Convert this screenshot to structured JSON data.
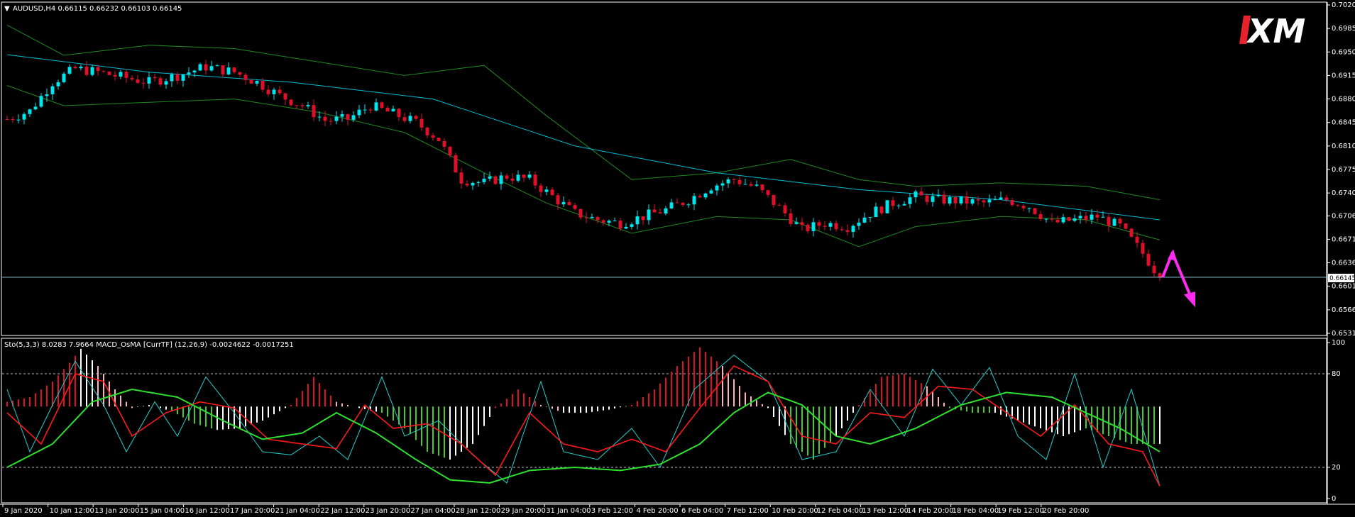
{
  "header": {
    "symbol_line": "AUDUSD,H4  0.66115 0.66232 0.66103 0.66145",
    "indicator_line": "Sto(5,3,3) 8.0283 7.9664  MACD_OsMA [CurrTF] (12,26,9) -0.0024622 -0.0017251"
  },
  "logo": {
    "text": "XM",
    "accent": "#e8222a"
  },
  "colors": {
    "background": "#000000",
    "bull_candle": "#00e5ee",
    "bear_candle": "#e0102a",
    "ma": "#00bcd4",
    "bands": "#1f8a1f",
    "price_line": "#9fdcf0",
    "arrow": "#ff2cf0",
    "sto_main": "#20d0d0",
    "sto_signal": "#ff1a1a",
    "macd_line": "#2ee02e",
    "hist_red": "#e0102a",
    "hist_pink": "#ffb0c0",
    "hist_white": "#ffffff",
    "hist_green": "#44cc22",
    "grid": "#bfbfbf"
  },
  "price_axis": {
    "ticks": [
      "0.70200",
      "0.69850",
      "0.69500",
      "0.69150",
      "0.68800",
      "0.68450",
      "0.68100",
      "0.67750",
      "0.67400",
      "0.67060",
      "0.66710",
      "0.66360",
      "0.66010",
      "0.65660",
      "0.65310"
    ],
    "current_price": "0.66145"
  },
  "indicator_axis": {
    "ticks": [
      "100",
      "80",
      "20",
      "0"
    ]
  },
  "time_axis": {
    "labels": [
      "9 Jan 2020",
      "10 Jan 12:00",
      "13 Jan 20:00",
      "15 Jan 04:00",
      "16 Jan 12:00",
      "17 Jan 20:00",
      "21 Jan 04:00",
      "22 Jan 12:00",
      "23 Jan 20:00",
      "27 Jan 04:00",
      "28 Jan 12:00",
      "29 Jan 20:00",
      "31 Jan 04:00",
      "3 Feb 12:00",
      "4 Feb 20:00",
      "6 Feb 04:00",
      "7 Feb 12:00",
      "10 Feb 20:00",
      "12 Feb 04:00",
      "13 Feb 12:00",
      "14 Feb 20:00",
      "18 Feb 04:00",
      "19 Feb 12:00",
      "20 Feb 20:00"
    ]
  },
  "chart_data": [
    {
      "type": "candlestick",
      "symbol": "AUDUSD",
      "timeframe": "H4",
      "ylim": [
        0.6531,
        0.702
      ],
      "close_path": [
        {
          "i": 0,
          "c": 0.685
        },
        {
          "i": 4,
          "c": 0.6862
        },
        {
          "i": 8,
          "c": 0.6905
        },
        {
          "i": 12,
          "c": 0.6925
        },
        {
          "i": 16,
          "c": 0.692
        },
        {
          "i": 20,
          "c": 0.6913
        },
        {
          "i": 25,
          "c": 0.6905
        },
        {
          "i": 30,
          "c": 0.6915
        },
        {
          "i": 35,
          "c": 0.6928
        },
        {
          "i": 40,
          "c": 0.692
        },
        {
          "i": 44,
          "c": 0.6905
        },
        {
          "i": 48,
          "c": 0.6885
        },
        {
          "i": 52,
          "c": 0.687
        },
        {
          "i": 56,
          "c": 0.6848
        },
        {
          "i": 60,
          "c": 0.685
        },
        {
          "i": 64,
          "c": 0.687
        },
        {
          "i": 68,
          "c": 0.6858
        },
        {
          "i": 72,
          "c": 0.6845
        },
        {
          "i": 76,
          "c": 0.682
        },
        {
          "i": 80,
          "c": 0.676
        },
        {
          "i": 84,
          "c": 0.6755
        },
        {
          "i": 88,
          "c": 0.6765
        },
        {
          "i": 92,
          "c": 0.676
        },
        {
          "i": 96,
          "c": 0.6735
        },
        {
          "i": 100,
          "c": 0.671
        },
        {
          "i": 104,
          "c": 0.67
        },
        {
          "i": 108,
          "c": 0.6695
        },
        {
          "i": 112,
          "c": 0.6705
        },
        {
          "i": 116,
          "c": 0.6715
        },
        {
          "i": 120,
          "c": 0.673
        },
        {
          "i": 124,
          "c": 0.675
        },
        {
          "i": 128,
          "c": 0.676
        },
        {
          "i": 132,
          "c": 0.6748
        },
        {
          "i": 136,
          "c": 0.6718
        },
        {
          "i": 140,
          "c": 0.6685
        },
        {
          "i": 144,
          "c": 0.6695
        },
        {
          "i": 148,
          "c": 0.669
        },
        {
          "i": 152,
          "c": 0.671
        },
        {
          "i": 156,
          "c": 0.6725
        },
        {
          "i": 160,
          "c": 0.6735
        },
        {
          "i": 164,
          "c": 0.673
        },
        {
          "i": 168,
          "c": 0.6728
        },
        {
          "i": 172,
          "c": 0.6725
        },
        {
          "i": 176,
          "c": 0.673
        },
        {
          "i": 180,
          "c": 0.672
        },
        {
          "i": 184,
          "c": 0.6695
        },
        {
          "i": 188,
          "c": 0.67
        },
        {
          "i": 192,
          "c": 0.6705
        },
        {
          "i": 196,
          "c": 0.669
        },
        {
          "i": 200,
          "c": 0.665
        },
        {
          "i": 203,
          "c": 0.66145
        }
      ],
      "moving_average": [
        {
          "i": 0,
          "v": 0.6946
        },
        {
          "i": 25,
          "v": 0.692
        },
        {
          "i": 50,
          "v": 0.6905
        },
        {
          "i": 75,
          "v": 0.688
        },
        {
          "i": 100,
          "v": 0.681
        },
        {
          "i": 125,
          "v": 0.677
        },
        {
          "i": 150,
          "v": 0.6745
        },
        {
          "i": 175,
          "v": 0.673
        },
        {
          "i": 203,
          "v": 0.67
        }
      ],
      "bollinger_upper": [
        {
          "i": 0,
          "v": 0.699
        },
        {
          "i": 10,
          "v": 0.6945
        },
        {
          "i": 25,
          "v": 0.696
        },
        {
          "i": 40,
          "v": 0.6955
        },
        {
          "i": 55,
          "v": 0.6935
        },
        {
          "i": 70,
          "v": 0.6915
        },
        {
          "i": 84,
          "v": 0.693
        },
        {
          "i": 95,
          "v": 0.6855
        },
        {
          "i": 110,
          "v": 0.676
        },
        {
          "i": 125,
          "v": 0.677
        },
        {
          "i": 138,
          "v": 0.679
        },
        {
          "i": 150,
          "v": 0.676
        },
        {
          "i": 160,
          "v": 0.675
        },
        {
          "i": 175,
          "v": 0.6755
        },
        {
          "i": 190,
          "v": 0.675
        },
        {
          "i": 203,
          "v": 0.673
        }
      ],
      "bollinger_lower": [
        {
          "i": 0,
          "v": 0.69
        },
        {
          "i": 10,
          "v": 0.687
        },
        {
          "i": 25,
          "v": 0.6875
        },
        {
          "i": 40,
          "v": 0.688
        },
        {
          "i": 55,
          "v": 0.686
        },
        {
          "i": 70,
          "v": 0.683
        },
        {
          "i": 84,
          "v": 0.677
        },
        {
          "i": 95,
          "v": 0.6725
        },
        {
          "i": 110,
          "v": 0.668
        },
        {
          "i": 125,
          "v": 0.6705
        },
        {
          "i": 138,
          "v": 0.67
        },
        {
          "i": 150,
          "v": 0.666
        },
        {
          "i": 160,
          "v": 0.669
        },
        {
          "i": 175,
          "v": 0.6705
        },
        {
          "i": 190,
          "v": 0.67
        },
        {
          "i": 203,
          "v": 0.667
        }
      ],
      "arrow": {
        "from": 0.66145,
        "peak": 0.6652,
        "target": 0.6574
      }
    },
    {
      "type": "oscillator",
      "name": "Sto(5,3,3) / MACD_OsMA",
      "ylim": [
        0,
        100
      ],
      "levels": [
        80,
        20
      ],
      "stochastic_main": [
        {
          "i": 0,
          "v": 70
        },
        {
          "i": 4,
          "v": 30
        },
        {
          "i": 8,
          "v": 60
        },
        {
          "i": 12,
          "v": 88
        },
        {
          "i": 17,
          "v": 60
        },
        {
          "i": 21,
          "v": 30
        },
        {
          "i": 26,
          "v": 62
        },
        {
          "i": 30,
          "v": 40
        },
        {
          "i": 35,
          "v": 78
        },
        {
          "i": 40,
          "v": 55
        },
        {
          "i": 45,
          "v": 30
        },
        {
          "i": 50,
          "v": 28
        },
        {
          "i": 55,
          "v": 40
        },
        {
          "i": 60,
          "v": 25
        },
        {
          "i": 66,
          "v": 78
        },
        {
          "i": 70,
          "v": 40
        },
        {
          "i": 76,
          "v": 50
        },
        {
          "i": 82,
          "v": 28
        },
        {
          "i": 88,
          "v": 10
        },
        {
          "i": 94,
          "v": 75
        },
        {
          "i": 98,
          "v": 30
        },
        {
          "i": 104,
          "v": 25
        },
        {
          "i": 110,
          "v": 45
        },
        {
          "i": 115,
          "v": 20
        },
        {
          "i": 121,
          "v": 70
        },
        {
          "i": 128,
          "v": 92
        },
        {
          "i": 134,
          "v": 75
        },
        {
          "i": 140,
          "v": 25
        },
        {
          "i": 146,
          "v": 30
        },
        {
          "i": 152,
          "v": 70
        },
        {
          "i": 158,
          "v": 40
        },
        {
          "i": 163,
          "v": 83
        },
        {
          "i": 168,
          "v": 60
        },
        {
          "i": 173,
          "v": 84
        },
        {
          "i": 178,
          "v": 40
        },
        {
          "i": 183,
          "v": 25
        },
        {
          "i": 188,
          "v": 80
        },
        {
          "i": 193,
          "v": 20
        },
        {
          "i": 198,
          "v": 70
        },
        {
          "i": 203,
          "v": 8
        }
      ],
      "stochastic_signal": [
        {
          "i": 0,
          "v": 55
        },
        {
          "i": 6,
          "v": 35
        },
        {
          "i": 12,
          "v": 80
        },
        {
          "i": 17,
          "v": 75
        },
        {
          "i": 22,
          "v": 40
        },
        {
          "i": 28,
          "v": 55
        },
        {
          "i": 34,
          "v": 62
        },
        {
          "i": 40,
          "v": 58
        },
        {
          "i": 46,
          "v": 38
        },
        {
          "i": 52,
          "v": 35
        },
        {
          "i": 58,
          "v": 32
        },
        {
          "i": 63,
          "v": 60
        },
        {
          "i": 68,
          "v": 45
        },
        {
          "i": 74,
          "v": 48
        },
        {
          "i": 80,
          "v": 35
        },
        {
          "i": 86,
          "v": 15
        },
        {
          "i": 92,
          "v": 55
        },
        {
          "i": 98,
          "v": 35
        },
        {
          "i": 104,
          "v": 30
        },
        {
          "i": 110,
          "v": 38
        },
        {
          "i": 116,
          "v": 30
        },
        {
          "i": 122,
          "v": 58
        },
        {
          "i": 128,
          "v": 85
        },
        {
          "i": 134,
          "v": 75
        },
        {
          "i": 140,
          "v": 40
        },
        {
          "i": 146,
          "v": 35
        },
        {
          "i": 152,
          "v": 55
        },
        {
          "i": 158,
          "v": 52
        },
        {
          "i": 164,
          "v": 72
        },
        {
          "i": 170,
          "v": 70
        },
        {
          "i": 176,
          "v": 55
        },
        {
          "i": 182,
          "v": 40
        },
        {
          "i": 188,
          "v": 60
        },
        {
          "i": 194,
          "v": 35
        },
        {
          "i": 200,
          "v": 30
        },
        {
          "i": 203,
          "v": 8
        }
      ],
      "macd_line": [
        {
          "i": 0,
          "v": 20
        },
        {
          "i": 8,
          "v": 35
        },
        {
          "i": 15,
          "v": 62
        },
        {
          "i": 22,
          "v": 70
        },
        {
          "i": 30,
          "v": 65
        },
        {
          "i": 38,
          "v": 50
        },
        {
          "i": 45,
          "v": 38
        },
        {
          "i": 52,
          "v": 42
        },
        {
          "i": 58,
          "v": 55
        },
        {
          "i": 65,
          "v": 42
        },
        {
          "i": 72,
          "v": 25
        },
        {
          "i": 78,
          "v": 12
        },
        {
          "i": 85,
          "v": 10
        },
        {
          "i": 92,
          "v": 18
        },
        {
          "i": 100,
          "v": 20
        },
        {
          "i": 108,
          "v": 18
        },
        {
          "i": 115,
          "v": 22
        },
        {
          "i": 122,
          "v": 35
        },
        {
          "i": 128,
          "v": 55
        },
        {
          "i": 134,
          "v": 68
        },
        {
          "i": 140,
          "v": 60
        },
        {
          "i": 146,
          "v": 40
        },
        {
          "i": 152,
          "v": 35
        },
        {
          "i": 160,
          "v": 45
        },
        {
          "i": 168,
          "v": 60
        },
        {
          "i": 176,
          "v": 68
        },
        {
          "i": 184,
          "v": 65
        },
        {
          "i": 190,
          "v": 55
        },
        {
          "i": 196,
          "v": 45
        },
        {
          "i": 203,
          "v": 30
        }
      ],
      "histogram": [
        {
          "i": 0,
          "v": 62,
          "c": "red"
        },
        {
          "i": 4,
          "v": 65,
          "c": "red"
        },
        {
          "i": 8,
          "v": 75,
          "c": "red"
        },
        {
          "i": 11,
          "v": 87,
          "c": "red"
        },
        {
          "i": 13,
          "v": 96,
          "c": "white"
        },
        {
          "i": 16,
          "v": 85,
          "c": "pink"
        },
        {
          "i": 19,
          "v": 70,
          "c": "pink"
        },
        {
          "i": 22,
          "v": 58,
          "c": "pink"
        },
        {
          "i": 25,
          "v": 60,
          "c": "white"
        },
        {
          "i": 29,
          "v": 56,
          "c": "green"
        },
        {
          "i": 33,
          "v": 48,
          "c": "green"
        },
        {
          "i": 37,
          "v": 44,
          "c": "white"
        },
        {
          "i": 41,
          "v": 45,
          "c": "white"
        },
        {
          "i": 45,
          "v": 50,
          "c": "white"
        },
        {
          "i": 50,
          "v": 60,
          "c": "red"
        },
        {
          "i": 54,
          "v": 78,
          "c": "red"
        },
        {
          "i": 58,
          "v": 62,
          "c": "pink"
        },
        {
          "i": 62,
          "v": 58,
          "c": "white"
        },
        {
          "i": 66,
          "v": 55,
          "c": "green"
        },
        {
          "i": 70,
          "v": 45,
          "c": "green"
        },
        {
          "i": 74,
          "v": 30,
          "c": "green"
        },
        {
          "i": 78,
          "v": 25,
          "c": "white"
        },
        {
          "i": 82,
          "v": 35,
          "c": "white"
        },
        {
          "i": 86,
          "v": 58,
          "c": "red"
        },
        {
          "i": 90,
          "v": 70,
          "c": "red"
        },
        {
          "i": 94,
          "v": 60,
          "c": "pink"
        },
        {
          "i": 98,
          "v": 55,
          "c": "white"
        },
        {
          "i": 102,
          "v": 55,
          "c": "white"
        },
        {
          "i": 106,
          "v": 57,
          "c": "white"
        },
        {
          "i": 110,
          "v": 60,
          "c": "red"
        },
        {
          "i": 114,
          "v": 70,
          "c": "red"
        },
        {
          "i": 118,
          "v": 85,
          "c": "red"
        },
        {
          "i": 122,
          "v": 97,
          "c": "red"
        },
        {
          "i": 126,
          "v": 85,
          "c": "pink"
        },
        {
          "i": 130,
          "v": 68,
          "c": "pink"
        },
        {
          "i": 134,
          "v": 58,
          "c": "white"
        },
        {
          "i": 138,
          "v": 35,
          "c": "green"
        },
        {
          "i": 142,
          "v": 25,
          "c": "green"
        },
        {
          "i": 146,
          "v": 40,
          "c": "white"
        },
        {
          "i": 150,
          "v": 60,
          "c": "red"
        },
        {
          "i": 154,
          "v": 78,
          "c": "red"
        },
        {
          "i": 158,
          "v": 80,
          "c": "red"
        },
        {
          "i": 162,
          "v": 72,
          "c": "pink"
        },
        {
          "i": 166,
          "v": 58,
          "c": "green"
        },
        {
          "i": 170,
          "v": 55,
          "c": "green"
        },
        {
          "i": 174,
          "v": 55,
          "c": "white"
        },
        {
          "i": 178,
          "v": 50,
          "c": "white"
        },
        {
          "i": 182,
          "v": 45,
          "c": "white"
        },
        {
          "i": 186,
          "v": 40,
          "c": "white"
        },
        {
          "i": 190,
          "v": 45,
          "c": "green"
        },
        {
          "i": 194,
          "v": 40,
          "c": "green"
        },
        {
          "i": 198,
          "v": 35,
          "c": "green"
        },
        {
          "i": 203,
          "v": 35,
          "c": "white"
        }
      ],
      "histogram_baseline": 59
    }
  ]
}
